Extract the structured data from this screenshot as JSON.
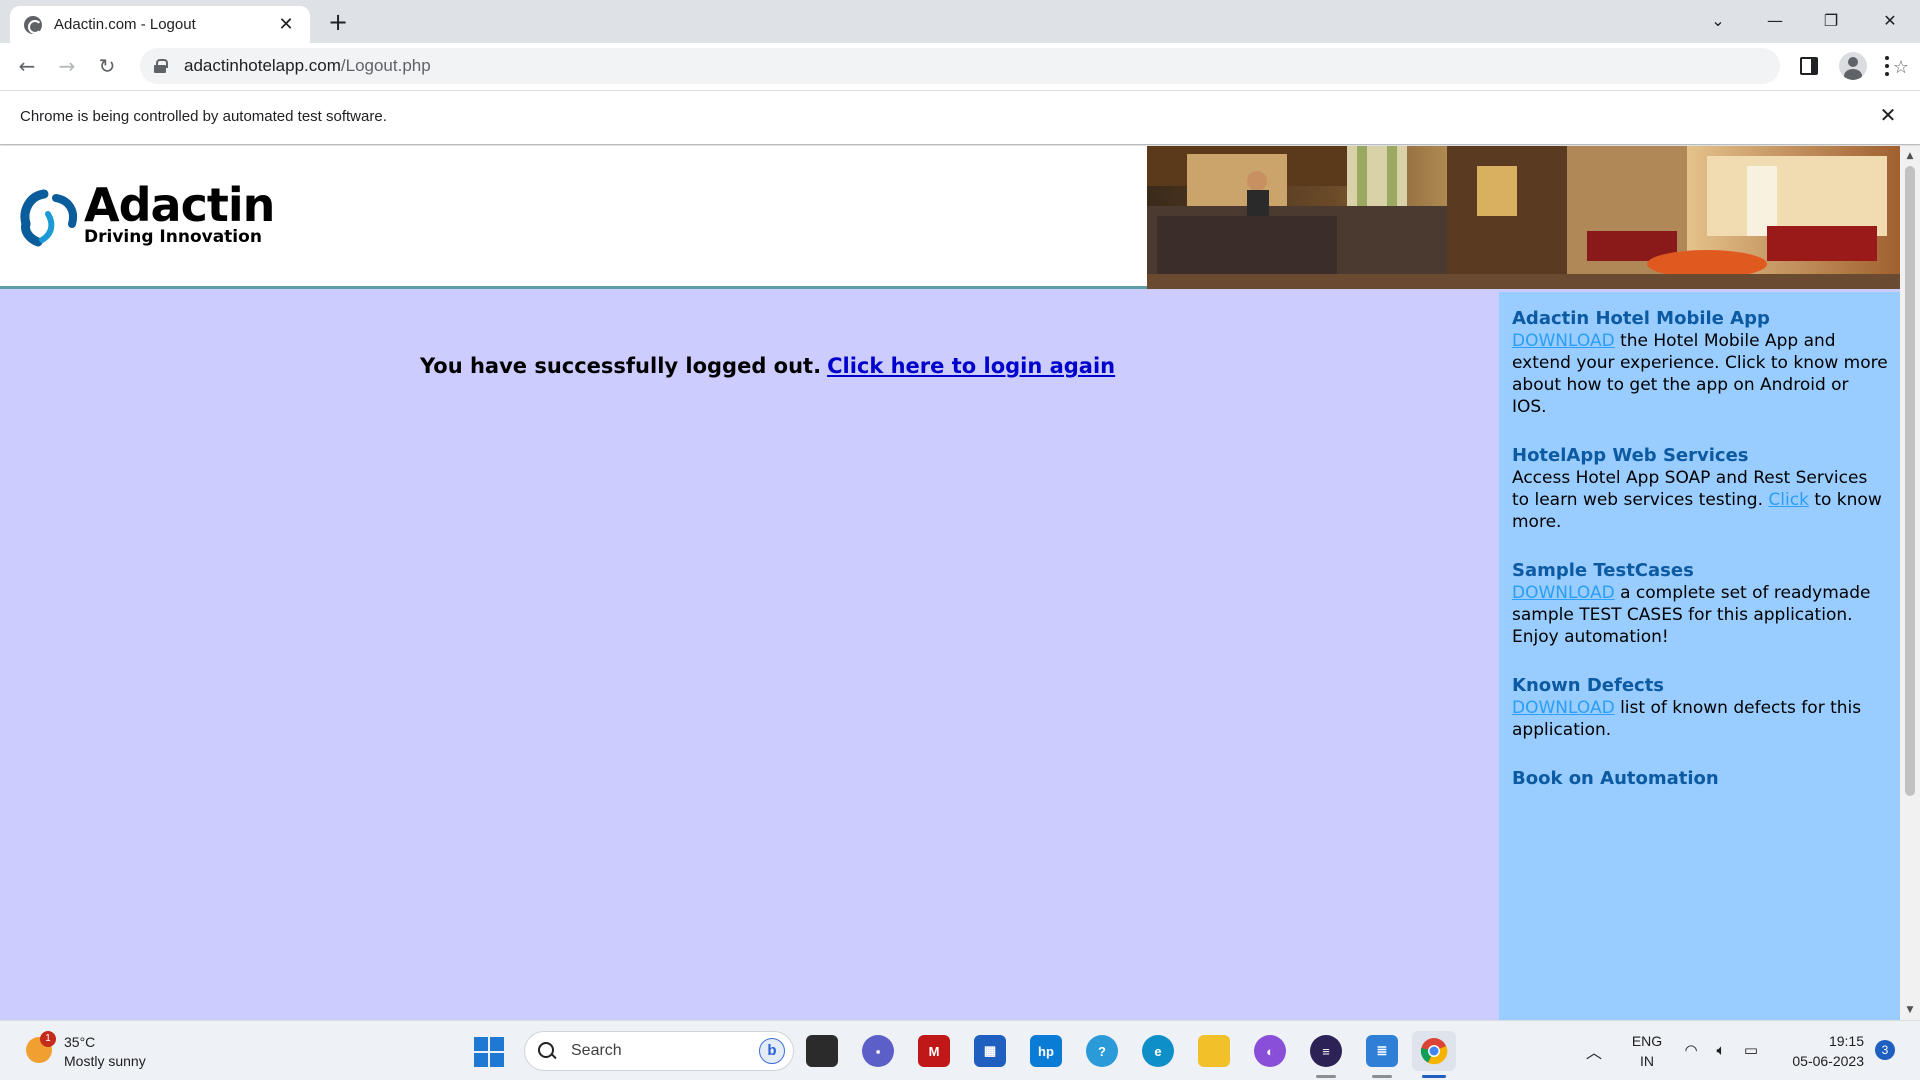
{
  "browser": {
    "tab_title": "Adactin.com - Logout",
    "url_host": "adactinhotelapp.com",
    "url_path": "/Logout.php",
    "infobar_text": "Chrome is being controlled by automated test software."
  },
  "header": {
    "logo_name": "Adactin",
    "logo_tagline": "Driving Innovation"
  },
  "main": {
    "logout_message": "You have successfully logged out.",
    "login_again_link": "Click here to login again"
  },
  "sidebar": {
    "mobile_app": {
      "title": "Adactin Hotel Mobile App",
      "link": "DOWNLOAD",
      "text": " the Hotel Mobile App and extend your experience. Click to know more about how to get the app on Android or IOS."
    },
    "web_services": {
      "title": "HotelApp Web Services",
      "text_before": "Access Hotel App SOAP and Rest Services to learn web services testing. ",
      "link": "Click",
      "text_after": " to know more."
    },
    "test_cases": {
      "title": "Sample TestCases",
      "link": "DOWNLOAD",
      "text": " a complete set of readymade sample TEST CASES for this application. Enjoy automation!"
    },
    "known_defects": {
      "title": "Known Defects",
      "link": "DOWNLOAD",
      "text": " list of known defects for this application."
    },
    "book": {
      "title": "Book on Automation"
    }
  },
  "taskbar": {
    "weather_temp": "35°C",
    "weather_desc": "Mostly sunny",
    "weather_badge": "1",
    "search_label": "Search",
    "lang_line1": "ENG",
    "lang_line2": "IN",
    "time": "19:15",
    "date": "05-06-2023",
    "notifications": "3",
    "apps": [
      "task-view",
      "meet",
      "mcafee",
      "store",
      "myhp",
      "help",
      "edge",
      "file-explorer",
      "vpn",
      "eclipse",
      "notepad",
      "chrome"
    ]
  },
  "colors": {
    "page_bg": "#ccccff",
    "sidebar_bg": "#99ccff",
    "sidebar_title": "#0b5aa2",
    "sidebar_link": "#2a9ff5",
    "login_link": "#0000cc"
  }
}
